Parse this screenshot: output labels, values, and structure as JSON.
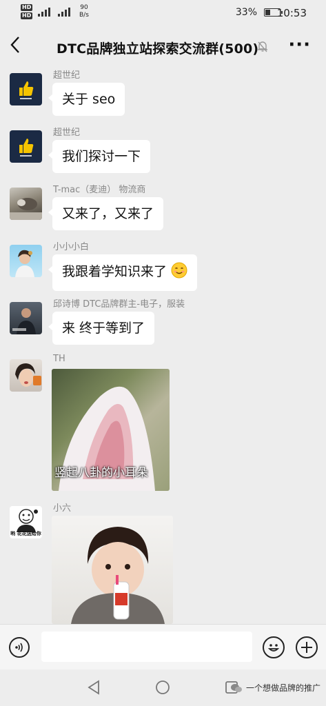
{
  "status_bar": {
    "sim1": "HD",
    "sim2": "HD",
    "net1": "4G",
    "net2": "4G",
    "speed_value": "90",
    "speed_unit": "B/s",
    "battery": "33%",
    "time": "10:53"
  },
  "header": {
    "title": "DTC品牌独立站探索交流群(500)",
    "back_icon": "chevron-left-icon",
    "mute_icon": "bell-off-icon",
    "more_icon": "more-dots-icon",
    "more_label": "···"
  },
  "messages": [
    {
      "sender": "超世纪",
      "text": "关于 seo",
      "avatar": "thumbs-up-logo"
    },
    {
      "sender": "超世纪",
      "text": "我们探讨一下",
      "avatar": "thumbs-up-logo"
    },
    {
      "sender": "T-mac（麦迪） 物流商",
      "text": "又来了，又来了",
      "avatar": "photo"
    },
    {
      "sender": "小小小白",
      "text": "我跟着学知识来了",
      "emoji": "smile-emoji",
      "avatar": "photo"
    },
    {
      "sender": "邱诗博 DTC品牌群主-电子，服装",
      "text": "来 终于等到了",
      "avatar": "photo"
    },
    {
      "sender": "TH",
      "image_caption": "竖起八卦的小耳朵",
      "avatar": "photo"
    },
    {
      "sender": "小六",
      "avatar_caption": "哟 花花送给你",
      "avatar": "sticker"
    }
  ],
  "input_bar": {
    "voice_icon": "voice-icon",
    "emoji_icon": "emoji-icon",
    "plus_icon": "plus-icon"
  },
  "nav": {
    "back_icon": "triangle-back-icon",
    "home_icon": "circle-home-icon",
    "recent_icon": "square-recent-icon",
    "watermark": "一个想做品牌的推广"
  },
  "colors": {
    "background": "#ededed",
    "bubble": "#ffffff",
    "logo_bg": "#1b2a44",
    "logo_accent": "#f5c400"
  }
}
